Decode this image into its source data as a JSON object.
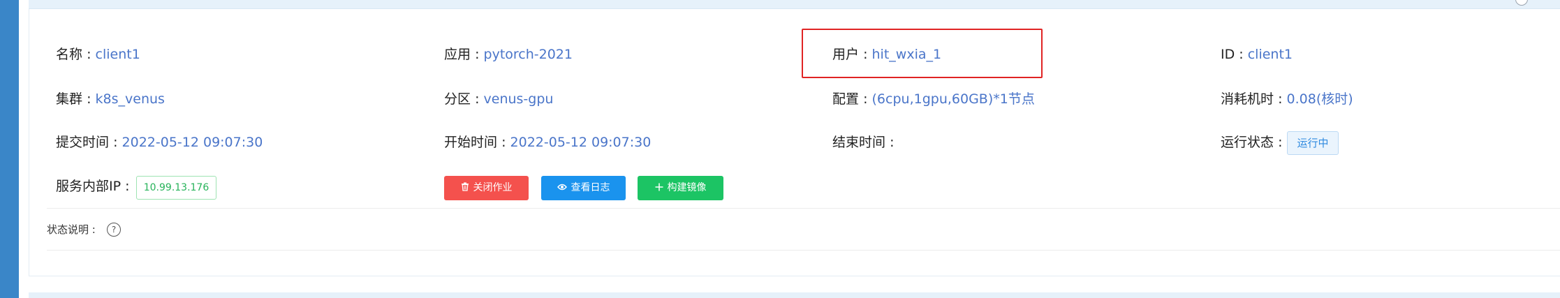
{
  "row1": {
    "name": {
      "label": "名称",
      "value": "client1"
    },
    "app": {
      "label": "应用",
      "value": "pytorch-2021"
    },
    "user": {
      "label": "用户",
      "value": "hit_wxia_1"
    },
    "id": {
      "label": "ID",
      "value": "client1"
    }
  },
  "row2": {
    "cluster": {
      "label": "集群",
      "value": "k8s_venus"
    },
    "partition": {
      "label": "分区",
      "value": "venus-gpu"
    },
    "config": {
      "label": "配置",
      "value": "(6cpu,1gpu,60GB)*1节点"
    },
    "cost": {
      "label": "消耗机时",
      "value": "0.08(核时)"
    }
  },
  "row3": {
    "submit_time": {
      "label": "提交时间",
      "value": "2022-05-12 09:07:30"
    },
    "start_time": {
      "label": "开始时间",
      "value": "2022-05-12 09:07:30"
    },
    "end_time": {
      "label": "结束时间",
      "value": ""
    },
    "run_status": {
      "label": "运行状态",
      "value": "运行中"
    }
  },
  "row4": {
    "service_ip": {
      "label": "服务内部IP",
      "value": "10.99.13.176"
    }
  },
  "separator": ":",
  "buttons": {
    "close_job": "关闭作业",
    "view_log": "查看日志",
    "build_image": "构建镜像"
  },
  "status_note": {
    "label": "状态说明 :",
    "help": "?"
  },
  "colors": {
    "value_link": "#4a75c9",
    "highlight_border": "#e02424",
    "btn_close": "#f4514d",
    "btn_log": "#1a93ee",
    "btn_build": "#1cc464",
    "status_running": "#2f8ae0",
    "ip_tag": "#27b35a"
  },
  "icons": {
    "close_job": "trash-icon",
    "view_log": "eye-icon",
    "build_image": "plus-icon",
    "help": "question-circle-icon"
  }
}
